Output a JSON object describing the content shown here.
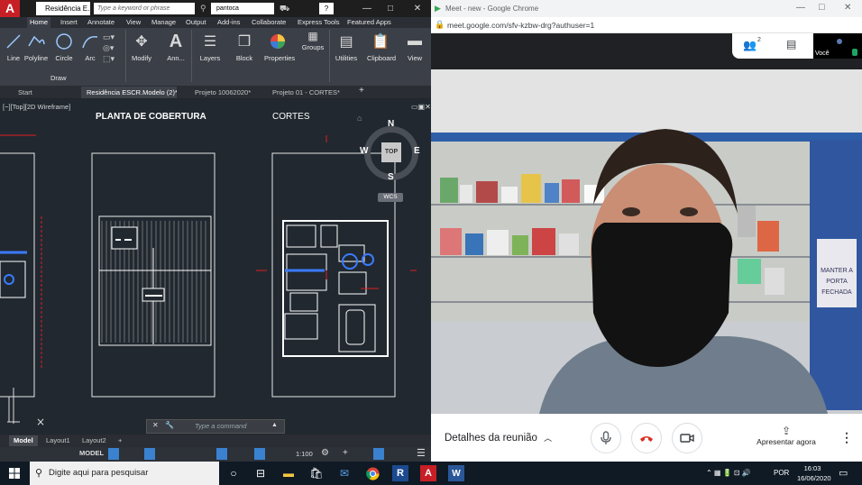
{
  "autocad": {
    "logo": "A",
    "doc_title": "Residência E...",
    "search_placeholder": "Type a keyword or phrase",
    "user": "pantoca",
    "help": "?",
    "ribbon_tabs": [
      "Home",
      "Insert",
      "Annotate",
      "View",
      "Manage",
      "Output",
      "Add-ins",
      "Collaborate",
      "Express Tools",
      "Featured Apps"
    ],
    "tools": [
      {
        "label": "Line",
        "icon": "line-icon"
      },
      {
        "label": "Polyline",
        "icon": "polyline-icon"
      },
      {
        "label": "Circle",
        "icon": "circle-icon"
      },
      {
        "label": "Arc",
        "icon": "arc-icon"
      },
      {
        "label": "Modify",
        "icon": "modify-icon"
      },
      {
        "label": "Ann...",
        "icon": "annotation-icon"
      },
      {
        "label": "Layers",
        "icon": "layers-icon"
      },
      {
        "label": "Block",
        "icon": "block-icon"
      },
      {
        "label": "Properties",
        "icon": "properties-icon"
      },
      {
        "label": "Groups",
        "icon": "groups-icon"
      },
      {
        "label": "Utilities",
        "icon": "utilities-icon"
      },
      {
        "label": "Clipboard",
        "icon": "clipboard-icon"
      },
      {
        "label": "View",
        "icon": "view-icon"
      }
    ],
    "draw_panel_label": "Draw",
    "doc_tabs": [
      "Start",
      "Residência ESCR.Modelo (2)*",
      "Projeto 10062020*",
      "Projeto 01 - CORTES*"
    ],
    "viewport_label": "[−][Top][2D Wireframe]",
    "drawing_titles": [
      "PLANTA DE COBERTURA",
      "CORTES"
    ],
    "viewcube": {
      "n": "N",
      "s": "S",
      "e": "E",
      "w": "W",
      "top": "TOP",
      "wcs": "WCS"
    },
    "command_placeholder": "Type a command",
    "layout_tabs": [
      "Model",
      "Layout1",
      "Layout2"
    ],
    "status_model": "MODEL",
    "status_scale": "1:100"
  },
  "chrome": {
    "window_title": "Meet - new - Google Chrome",
    "url": "meet.google.com/sfv-kzbw-drg?authuser=1"
  },
  "meet": {
    "participants_count": "2",
    "self_label": "Você",
    "meeting_details": "Detalhes da reunião",
    "present_now": "Apresentar agora",
    "shelf_sign": "MANTER A PORTA FECHADA",
    "colors": {
      "end_call": "#d93025",
      "accent": "#1a73e8"
    }
  },
  "taskbar": {
    "search_placeholder": "Digite aqui para pesquisar",
    "language": "POR",
    "time": "16:03",
    "date": "16/06/2020"
  }
}
